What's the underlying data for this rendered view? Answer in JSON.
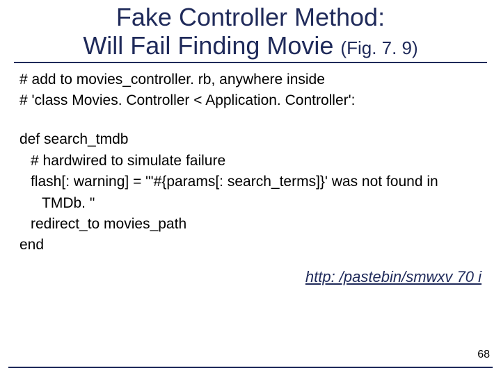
{
  "title": {
    "line1": "Fake Controller Method:",
    "line2_main": "Will Fail Finding Movie ",
    "line2_ref": "(Fig. 7. 9)"
  },
  "comments": {
    "c1": "# add to movies_controller. rb, anywhere inside",
    "c2": "#  'class Movies. Controller < Application. Controller':"
  },
  "code": {
    "def_line": "def search_tmdb",
    "comment_hardwired": "# hardwired to simulate failure",
    "flash_line": "flash[: warning] = \"'#{params[: search_terms]}' was not found in",
    "flash_line2": "TMDb. \"",
    "redirect_line": "redirect_to movies_path",
    "end_line": "end"
  },
  "link_text": "http: /pastebin/smwxv 70 i",
  "page_number": "68"
}
